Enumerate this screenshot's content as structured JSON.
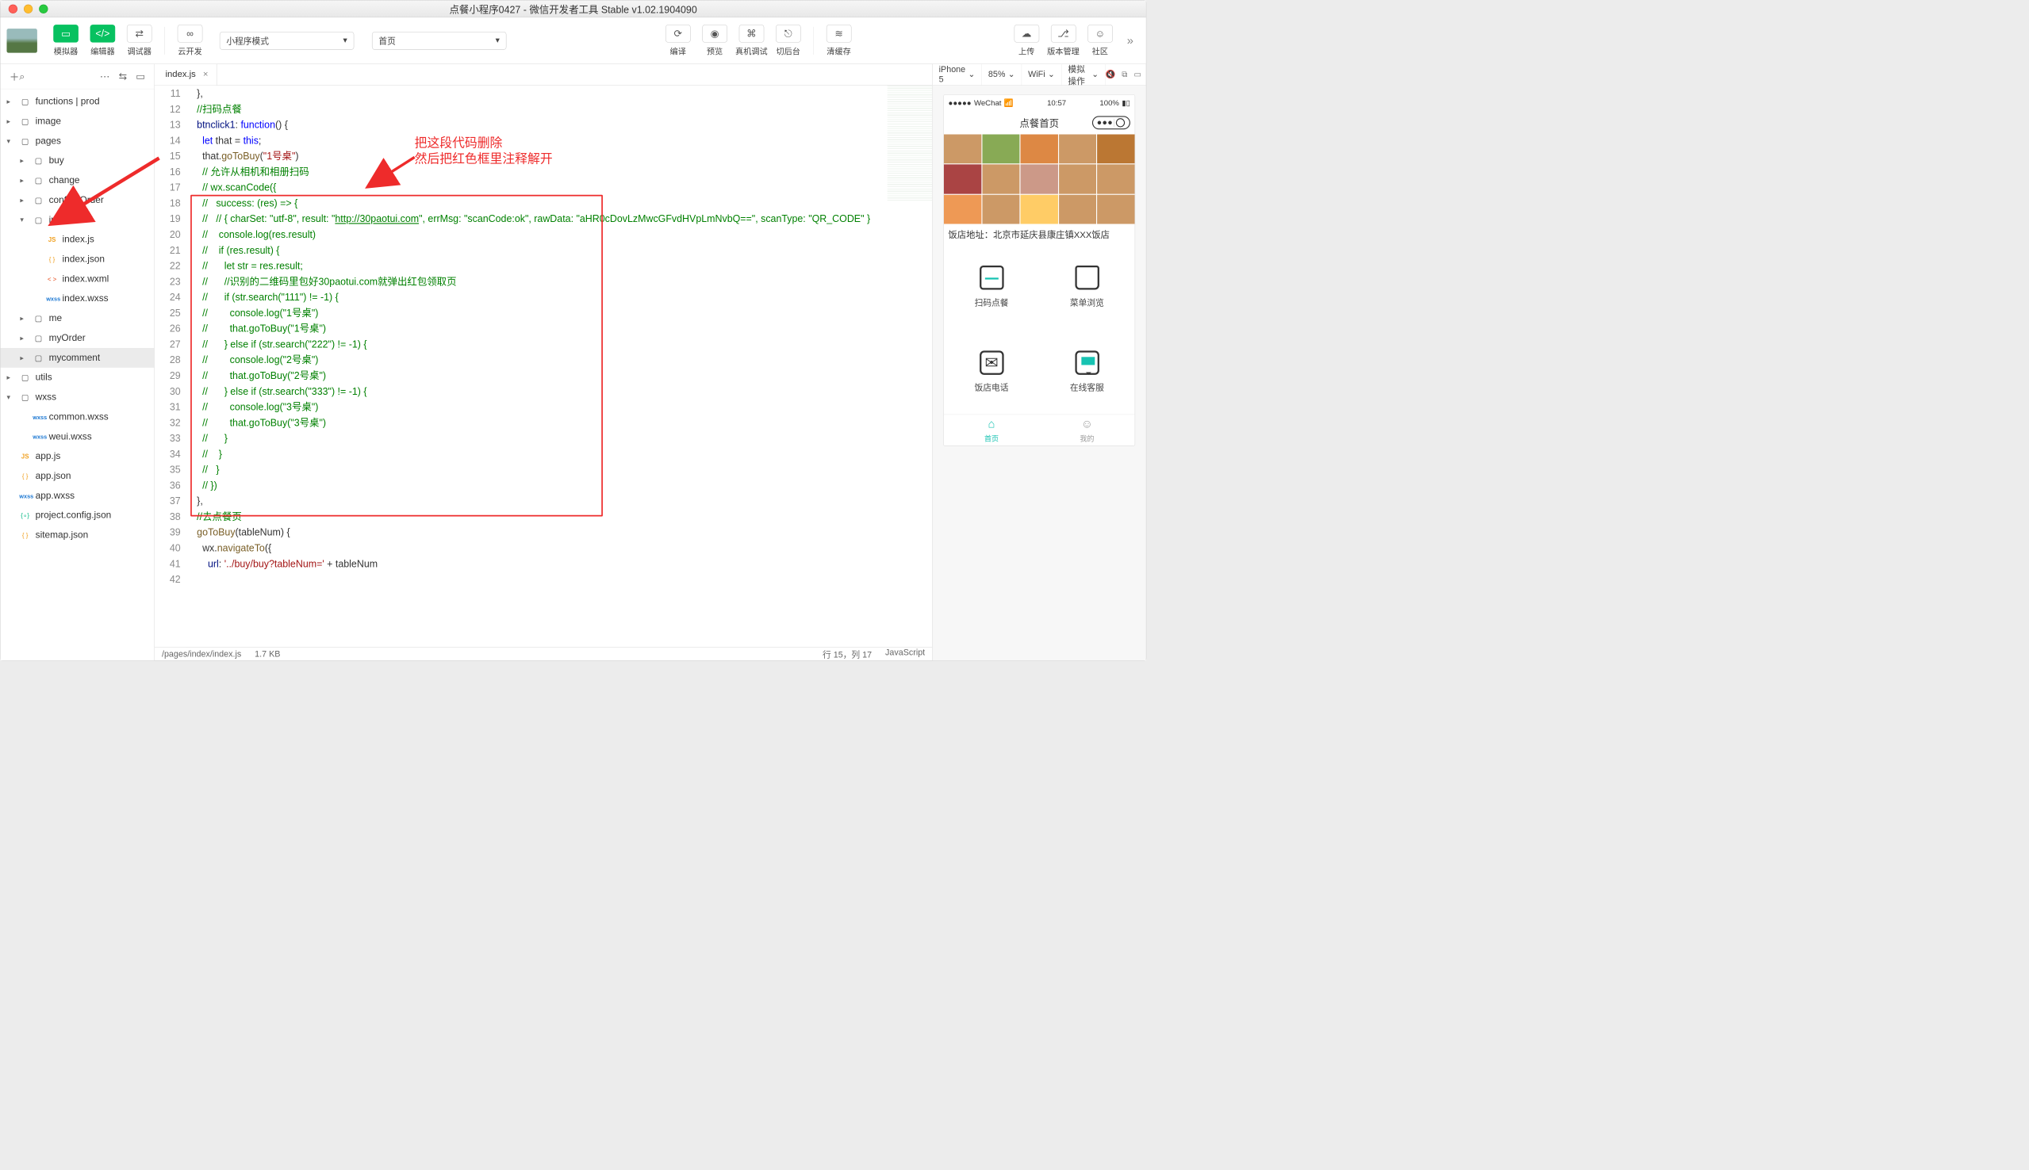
{
  "window": {
    "title": "点餐小程序0427 - 微信开发者工具 Stable v1.02.1904090"
  },
  "toolbar": {
    "simulator": "模拟器",
    "editor": "编辑器",
    "debugger": "调试器",
    "cloud": "云开发",
    "mode": "小程序模式",
    "page": "首页",
    "compile": "编译",
    "preview": "预览",
    "remote": "真机调试",
    "background": "切后台",
    "clearCache": "清缓存",
    "upload": "上传",
    "version": "版本管理",
    "community": "社区"
  },
  "tree": [
    {
      "d": 1,
      "c": "▸",
      "i": "folder",
      "t": "functions | prod"
    },
    {
      "d": 1,
      "c": "▸",
      "i": "folder",
      "t": "image"
    },
    {
      "d": 1,
      "c": "▾",
      "i": "folder",
      "t": "pages"
    },
    {
      "d": 2,
      "c": "▸",
      "i": "folder",
      "t": "buy"
    },
    {
      "d": 2,
      "c": "▸",
      "i": "folder",
      "t": "change"
    },
    {
      "d": 2,
      "c": "▸",
      "i": "folder",
      "t": "confirmOrder"
    },
    {
      "d": 2,
      "c": "▾",
      "i": "folder",
      "t": "index"
    },
    {
      "d": 3,
      "c": "",
      "i": "js",
      "t": "index.js"
    },
    {
      "d": 3,
      "c": "",
      "i": "json",
      "t": "index.json"
    },
    {
      "d": 3,
      "c": "",
      "i": "wxml",
      "t": "index.wxml"
    },
    {
      "d": 3,
      "c": "",
      "i": "wxss",
      "t": "index.wxss"
    },
    {
      "d": 2,
      "c": "▸",
      "i": "folder",
      "t": "me"
    },
    {
      "d": 2,
      "c": "▸",
      "i": "folder",
      "t": "myOrder"
    },
    {
      "d": 2,
      "c": "▸",
      "i": "folder",
      "t": "mycomment",
      "sel": true
    },
    {
      "d": 1,
      "c": "▸",
      "i": "folder",
      "t": "utils"
    },
    {
      "d": 1,
      "c": "▾",
      "i": "folder",
      "t": "wxss"
    },
    {
      "d": 2,
      "c": "",
      "i": "wxss",
      "t": "common.wxss"
    },
    {
      "d": 2,
      "c": "",
      "i": "wxss",
      "t": "weui.wxss"
    },
    {
      "d": 1,
      "c": "",
      "i": "js",
      "t": "app.js"
    },
    {
      "d": 1,
      "c": "",
      "i": "json",
      "t": "app.json"
    },
    {
      "d": 1,
      "c": "",
      "i": "wxss",
      "t": "app.wxss"
    },
    {
      "d": 1,
      "c": "",
      "i": "cfg",
      "t": "project.config.json"
    },
    {
      "d": 1,
      "c": "",
      "i": "json",
      "t": "sitemap.json"
    }
  ],
  "tab": {
    "name": "index.js"
  },
  "annotation": {
    "line1": "把这段代码删除",
    "line2": "然后把红色框里注释解开"
  },
  "code": {
    "start": 11,
    "lines": [
      {
        "n": 11,
        "h": "  },"
      },
      {
        "n": 12,
        "h": ""
      },
      {
        "n": 13,
        "h": "  <span class='c-com'>//扫码点餐</span>"
      },
      {
        "n": 14,
        "h": "  <span class='c-id'>btnclick1</span>: <span class='c-kw'>function</span>() {"
      },
      {
        "n": 15,
        "h": "    <span class='c-kw'>let</span> that = <span class='c-kw'>this</span>;"
      },
      {
        "n": 16,
        "h": "    that.<span class='c-fn'>goToBuy</span>(<span class='c-str'>\"1号桌\"</span>)"
      },
      {
        "n": 17,
        "h": "    <span class='c-com'>// 允许从相机和相册扫码</span>"
      },
      {
        "n": 18,
        "h": "    <span class='c-com'>// wx.scanCode({</span>"
      },
      {
        "n": 19,
        "h": "    <span class='c-com'>//   success: (res) =&gt; {</span>"
      },
      {
        "n": 20,
        "h": "    <span class='c-com'>//   // { charSet: \"utf-8\", result: \"<u>http://30paotui.com</u>\", errMsg: \"scanCode:ok\", rawData: \"aHR0cDovLzMwcGFvdHVpLmNvbQ==\", scanType: \"QR_CODE\" }</span>"
      },
      {
        "n": 21,
        "h": "    <span class='c-com'>//    console.log(res.result)</span>"
      },
      {
        "n": 22,
        "h": "    <span class='c-com'>//    if (res.result) {</span>"
      },
      {
        "n": 23,
        "h": "    <span class='c-com'>//      let str = res.result;</span>"
      },
      {
        "n": 24,
        "h": "    <span class='c-com'>//      //识别的二维码里包好30paotui.com就弹出红包领取页</span>"
      },
      {
        "n": 25,
        "h": "    <span class='c-com'>//      if (str.search(\"111\") != -1) {</span>"
      },
      {
        "n": 26,
        "h": "    <span class='c-com'>//        console.log(\"1号桌\")</span>"
      },
      {
        "n": 27,
        "h": "    <span class='c-com'>//        that.goToBuy(\"1号桌\")</span>"
      },
      {
        "n": 28,
        "h": "    <span class='c-com'>//      } else if (str.search(\"222\") != -1) {</span>"
      },
      {
        "n": 29,
        "h": "    <span class='c-com'>//        console.log(\"2号桌\")</span>"
      },
      {
        "n": 30,
        "h": "    <span class='c-com'>//        that.goToBuy(\"2号桌\")</span>"
      },
      {
        "n": 31,
        "h": "    <span class='c-com'>//      } else if (str.search(\"333\") != -1) {</span>"
      },
      {
        "n": 32,
        "h": "    <span class='c-com'>//        console.log(\"3号桌\")</span>"
      },
      {
        "n": 33,
        "h": "    <span class='c-com'>//        that.goToBuy(\"3号桌\")</span>"
      },
      {
        "n": 34,
        "h": "    <span class='c-com'>//      }</span>"
      },
      {
        "n": 35,
        "h": "    <span class='c-com'>//    }</span>"
      },
      {
        "n": 36,
        "h": "    <span class='c-com'>//   }</span>"
      },
      {
        "n": 37,
        "h": "    <span class='c-com'>// })</span>"
      },
      {
        "n": 38,
        "h": "  },"
      },
      {
        "n": 39,
        "h": "  <span class='c-com'>//去点餐页</span>"
      },
      {
        "n": 40,
        "h": "  <span class='c-fn'>goToBuy</span>(tableNum) {"
      },
      {
        "n": 41,
        "h": "    wx.<span class='c-fn'>navigateTo</span>({"
      },
      {
        "n": 42,
        "h": "      <span class='c-id'>url</span>: <span class='c-str'>'../buy/buy?tableNum='</span> + tableNum"
      }
    ]
  },
  "status": {
    "path": "/pages/index/index.js",
    "size": "1.7 KB",
    "pos": "行 15，列 17",
    "lang": "JavaScript"
  },
  "sim": {
    "device": "iPhone 5",
    "zoom": "85%",
    "net": "WiFi",
    "action": "模拟操作",
    "carrier": "WeChat",
    "time": "10:57",
    "battery": "100%",
    "navTitle": "点餐首页",
    "addr": "饭店地址：北京市延庆县康庄镇XXX饭店",
    "cells": [
      "扫码点餐",
      "菜单浏览",
      "饭店电话",
      "在线客服"
    ],
    "tabs": [
      "首页",
      "我的"
    ]
  }
}
